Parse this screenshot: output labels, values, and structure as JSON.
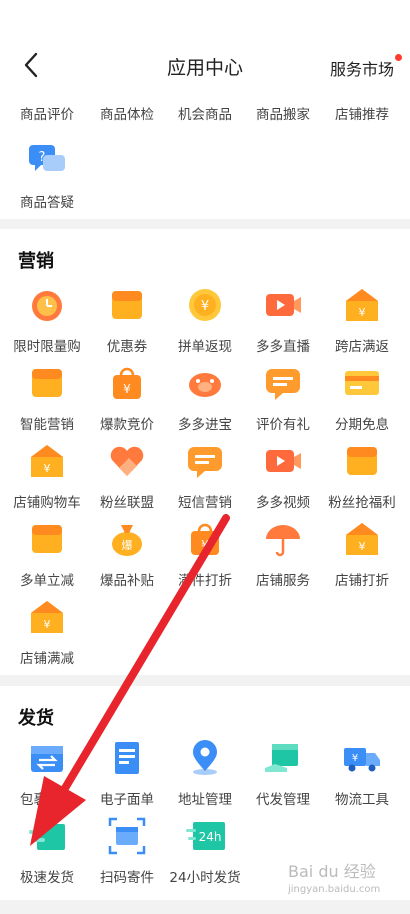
{
  "header": {
    "title": "应用中心",
    "market": "服务市场"
  },
  "top_partial": {
    "row1": [
      "商品评价",
      "商品体检",
      "机会商品",
      "商品搬家",
      "店铺推荐"
    ],
    "row2": [
      "商品答疑"
    ]
  },
  "marketing": {
    "title": "营销",
    "items": [
      "限时限量购",
      "优惠券",
      "拼单返现",
      "多多直播",
      "跨店满返",
      "智能营销",
      "爆款竞价",
      "多多进宝",
      "评价有礼",
      "分期免息",
      "店铺购物车",
      "粉丝联盟",
      "短信营销",
      "多多视频",
      "粉丝抢福利",
      "多单立减",
      "爆品补贴",
      "满件打折",
      "店铺服务",
      "店铺打折",
      "店铺满减"
    ]
  },
  "shipping": {
    "title": "发货",
    "items": [
      "包裹中心",
      "电子面单",
      "地址管理",
      "代发管理",
      "物流工具",
      "极速发货",
      "扫码寄件",
      "24小时发货"
    ]
  },
  "watermark": {
    "brand": "Bai du 经验",
    "url": "jingyan.baidu.com"
  },
  "colors": {
    "orange": "#ff8a1f",
    "teal": "#1fc6a6",
    "blue": "#3a8ef6",
    "arrow": "#e8242c"
  }
}
